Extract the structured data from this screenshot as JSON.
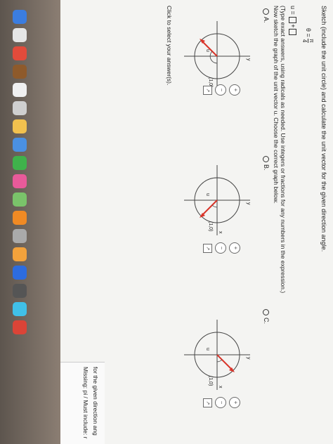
{
  "question": {
    "instruction": "Sketch (include the unit circle) and calculate the unit vector for the given direction angle.",
    "theta_label": "θ =",
    "theta_num": "π",
    "theta_den": "4",
    "u_label": "u =",
    "plus": "+",
    "hint": "(Type exact answers, using radicals as needed. Use integers or fractions for any numbers in the expression.)",
    "sketch": "Now sketch the graph of the unit vector u. Choose the correct graph below.",
    "click_hint": "Click to select your answer(s)."
  },
  "options": [
    {
      "label": "A.",
      "tick": "(1,0)",
      "u": "u",
      "x": "x",
      "y": "y"
    },
    {
      "label": "B.",
      "tick": "(1,0)",
      "u": "u",
      "x": "x",
      "y": "y"
    },
    {
      "label": "C.",
      "tick": "(1,0)",
      "u": "u",
      "x": "x",
      "y": "y"
    }
  ],
  "side_panel": {
    "line1": "for the given direction ang",
    "line2": "Missing: pi / Must include: r"
  },
  "colors": {
    "vector": "#d9352a",
    "accent": "#e8b23a"
  }
}
